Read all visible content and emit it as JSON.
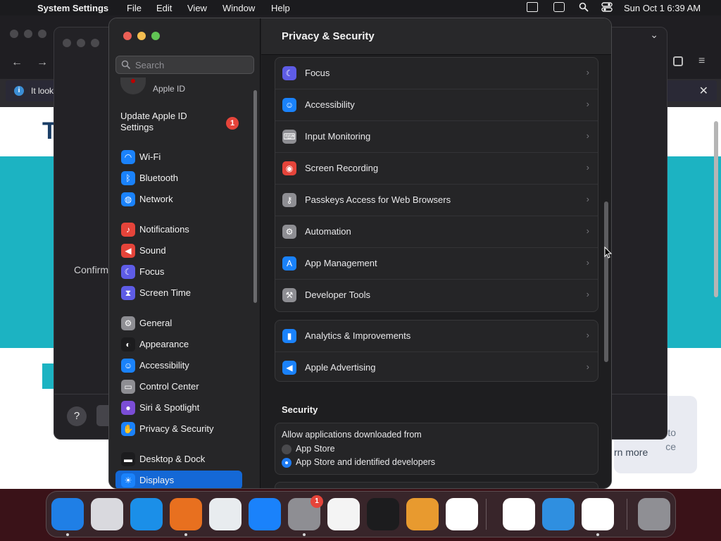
{
  "menubar": {
    "app_name": "System Settings",
    "items": [
      "File",
      "Edit",
      "View",
      "Window",
      "Help"
    ],
    "clock": "Sun Oct 1  6:39 AM"
  },
  "background": {
    "info_text": "It look",
    "info_close": "✕",
    "page_letter": "T",
    "confirm_text": "Confirm",
    "card_line1": "to",
    "card_line2": "ce",
    "card_learn": "rn more",
    "help_label": "?"
  },
  "sidebar": {
    "search_placeholder": "Search",
    "account_label": "Apple ID",
    "update_text": "Update Apple ID Settings",
    "update_badge": "1",
    "items": [
      {
        "label": "Wi-Fi",
        "icon": "wifi-icon",
        "color": "#1a82fb"
      },
      {
        "label": "Bluetooth",
        "icon": "bluetooth-icon",
        "color": "#1a82fb"
      },
      {
        "label": "Network",
        "icon": "globe-icon",
        "color": "#1a82fb"
      },
      {
        "label": "Notifications",
        "icon": "bell-icon",
        "color": "#e5443a"
      },
      {
        "label": "Sound",
        "icon": "speaker-icon",
        "color": "#e5443a"
      },
      {
        "label": "Focus",
        "icon": "moon-icon",
        "color": "#5e5ce6"
      },
      {
        "label": "Screen Time",
        "icon": "hourglass-icon",
        "color": "#5e5ce6"
      },
      {
        "label": "General",
        "icon": "gear-icon",
        "color": "#8e8e93"
      },
      {
        "label": "Appearance",
        "icon": "appearance-icon",
        "color": "#1c1c1e"
      },
      {
        "label": "Accessibility",
        "icon": "accessibility-icon",
        "color": "#1a82fb"
      },
      {
        "label": "Control Center",
        "icon": "toggles-icon",
        "color": "#8e8e93"
      },
      {
        "label": "Siri & Spotlight",
        "icon": "siri-icon",
        "color": "#7b4dd6"
      },
      {
        "label": "Privacy & Security",
        "icon": "hand-icon",
        "color": "#1a82fb"
      },
      {
        "label": "Desktop & Dock",
        "icon": "dock-icon",
        "color": "#1c1c1e"
      },
      {
        "label": "Displays",
        "icon": "sun-icon",
        "color": "#1a82fb"
      }
    ]
  },
  "content": {
    "title": "Privacy & Security",
    "group1": [
      {
        "label": "Focus",
        "icon": "moon-icon",
        "color": "#5e5ce6"
      },
      {
        "label": "Accessibility",
        "icon": "accessibility-icon",
        "color": "#1a82fb"
      },
      {
        "label": "Input Monitoring",
        "icon": "keyboard-icon",
        "color": "#8e8e93"
      },
      {
        "label": "Screen Recording",
        "icon": "record-icon",
        "color": "#e5443a"
      },
      {
        "label": "Passkeys Access for Web Browsers",
        "icon": "person-key-icon",
        "color": "#8e8e93"
      },
      {
        "label": "Automation",
        "icon": "gears-icon",
        "color": "#8e8e93"
      },
      {
        "label": "App Management",
        "icon": "app-store-icon",
        "color": "#1a82fb"
      },
      {
        "label": "Developer Tools",
        "icon": "hammer-icon",
        "color": "#8e8e93"
      }
    ],
    "group2": [
      {
        "label": "Analytics & Improvements",
        "icon": "chart-icon",
        "color": "#1a82fb"
      },
      {
        "label": "Apple Advertising",
        "icon": "megaphone-icon",
        "color": "#1a82fb"
      }
    ],
    "chevron": "›",
    "security_title": "Security",
    "allow_text": "Allow applications downloaded from",
    "radio_options": [
      {
        "label": "App Store",
        "selected": false
      },
      {
        "label": "App Store and identified developers",
        "selected": true
      }
    ]
  },
  "dock": {
    "apps": [
      {
        "name": "finder-icon",
        "color": "#1f7fe6",
        "running": true
      },
      {
        "name": "launchpad-icon",
        "color": "#d9d9de",
        "running": false
      },
      {
        "name": "safari-icon",
        "color": "#1b8fe8",
        "running": false
      },
      {
        "name": "firefox-icon",
        "color": "#e8701f",
        "running": true
      },
      {
        "name": "chrome-icon",
        "color": "#e8ecef",
        "running": false
      },
      {
        "name": "app-store-icon",
        "color": "#1a82fb",
        "running": false
      },
      {
        "name": "system-settings-icon",
        "color": "#8e8e93",
        "running": true,
        "badge": "1"
      },
      {
        "name": "textedit-icon",
        "color": "#f4f4f4",
        "running": false
      },
      {
        "name": "terminal-icon",
        "color": "#1c1c1e",
        "running": false
      },
      {
        "name": "garageband-icon",
        "color": "#e89a2f",
        "running": false
      },
      {
        "name": "vscode-icon",
        "color": "#ffffff",
        "running": false
      },
      {
        "name": "visual-studio-icon",
        "color": "#ffffff",
        "running": false
      },
      {
        "name": "weather-icon",
        "color": "#2f8fe0",
        "running": false
      },
      {
        "name": "remote-desktop-icon",
        "color": "#ffffff",
        "running": true
      },
      {
        "name": "trash-icon",
        "color": "#8f8f94",
        "running": false
      }
    ]
  }
}
